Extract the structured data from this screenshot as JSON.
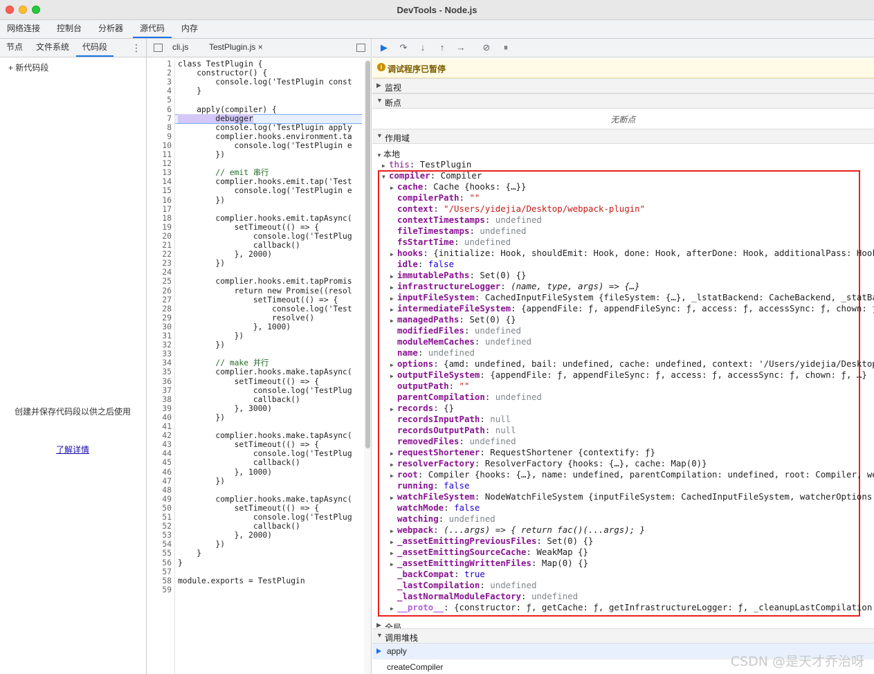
{
  "window": {
    "title": "DevTools - Node.js"
  },
  "main_tabs": [
    "网络连接",
    "控制台",
    "分析器",
    "源代码",
    "内存"
  ],
  "sources": {
    "sub_tabs": [
      "节点",
      "文件系统",
      "代码段"
    ],
    "new_snippet": "新代码段",
    "empty_message": "创建并保存代码段以供之后使用",
    "learn_more": "了解详情"
  },
  "editor": {
    "tabs": [
      {
        "label": "cli.js"
      },
      {
        "label": "TestPlugin.js",
        "close": "×"
      }
    ],
    "line_numbers": [
      "1",
      "2",
      "3",
      "4",
      "5",
      "6",
      "7",
      "8",
      "9",
      "10",
      "11",
      "12",
      "13",
      "14",
      "15",
      "16",
      "17",
      "18",
      "19",
      "20",
      "21",
      "22",
      "23",
      "24",
      "25",
      "26",
      "27",
      "28",
      "29",
      "30",
      "31",
      "32",
      "33",
      "34",
      "35",
      "36",
      "37",
      "38",
      "39",
      "40",
      "41",
      "42",
      "43",
      "44",
      "45",
      "46",
      "47",
      "48",
      "49",
      "50",
      "51",
      "52",
      "53",
      "54",
      "55",
      "56",
      "57",
      "58",
      "59"
    ],
    "lines": [
      "class TestPlugin {",
      "    constructor() {",
      "        console.log('TestPlugin const",
      "    }",
      "",
      "    apply(compiler) {",
      "        debugger",
      "        console.log('TestPlugin apply",
      "        complier.hooks.environment.ta",
      "            console.log('TestPlugin e",
      "        })",
      "",
      "        // emit 串行",
      "        complier.hooks.emit.tap('Test",
      "            console.log('TestPlugin e",
      "        })",
      "",
      "        complier.hooks.emit.tapAsync(",
      "            setTimeout(() => {",
      "                console.log('TestPlug",
      "                callback()",
      "            }, 2000)",
      "        })",
      "",
      "        complier.hooks.emit.tapPromis",
      "            return new Promise((resol",
      "                setTimeout(() => {",
      "                    console.log('Test",
      "                    resolve()",
      "                }, 1000)",
      "            })",
      "        })",
      "",
      "        // make 并行",
      "        complier.hooks.make.tapAsync(",
      "            setTimeout(() => {",
      "                console.log('TestPlug",
      "                callback()",
      "            }, 3000)",
      "        })",
      "",
      "        complier.hooks.make.tapAsync(",
      "            setTimeout(() => {",
      "                console.log('TestPlug",
      "                callback()",
      "            }, 1000)",
      "        })",
      "",
      "        complier.hooks.make.tapAsync(",
      "            setTimeout(() => {",
      "                console.log('TestPlug",
      "                callback()",
      "            }, 2000)",
      "        })",
      "    }",
      "}",
      "",
      "module.exports = TestPlugin",
      ""
    ]
  },
  "debugger": {
    "paused": "调试程序已暂停",
    "sections": {
      "watch": "监视",
      "breakpoints": "断点",
      "scope": "作用域",
      "local": "本地",
      "global": "全局",
      "callstack": "调用堆栈"
    },
    "no_breakpoints": "无断点",
    "this_row": {
      "key": "this",
      "value": "TestPlugin"
    },
    "compiler_row": {
      "key": "compiler",
      "value": "Compiler"
    },
    "props": [
      {
        "k": "cache",
        "v": "Cache {hooks: {…}}",
        "t": "obj",
        "exp": true
      },
      {
        "k": "compilerPath",
        "v": "\"\"",
        "t": "str",
        "exp": false
      },
      {
        "k": "context",
        "v": "\"/Users/yidejia/Desktop/webpack-plugin\"",
        "t": "str",
        "exp": false
      },
      {
        "k": "contextTimestamps",
        "v": "undefined",
        "t": "undef",
        "exp": false
      },
      {
        "k": "fileTimestamps",
        "v": "undefined",
        "t": "undef",
        "exp": false
      },
      {
        "k": "fsStartTime",
        "v": "undefined",
        "t": "undef",
        "exp": false
      },
      {
        "k": "hooks",
        "v": "{initialize: Hook, shouldEmit: Hook, done: Hook, afterDone: Hook, additionalPass: Hook, …",
        "t": "obj",
        "exp": true
      },
      {
        "k": "idle",
        "v": "false",
        "t": "num",
        "exp": false
      },
      {
        "k": "immutablePaths",
        "v": "Set(0) {}",
        "t": "obj",
        "exp": true
      },
      {
        "k": "infrastructureLogger",
        "v": "(name, type, args) => {…}",
        "t": "fn",
        "exp": true
      },
      {
        "k": "inputFileSystem",
        "v": "CachedInputFileSystem {fileSystem: {…}, _lstatBackend: CacheBackend, _statBacke",
        "t": "obj",
        "exp": true
      },
      {
        "k": "intermediateFileSystem",
        "v": "{appendFile: ƒ, appendFileSync: ƒ, access: ƒ, accessSync: ƒ, chown: ƒ, …",
        "t": "obj",
        "exp": true
      },
      {
        "k": "managedPaths",
        "v": "Set(0) {}",
        "t": "obj",
        "exp": true
      },
      {
        "k": "modifiedFiles",
        "v": "undefined",
        "t": "undef",
        "exp": false
      },
      {
        "k": "moduleMemCaches",
        "v": "undefined",
        "t": "undef",
        "exp": false
      },
      {
        "k": "name",
        "v": "undefined",
        "t": "undef",
        "exp": false
      },
      {
        "k": "options",
        "v": "{amd: undefined, bail: undefined, cache: undefined, context: '/Users/yidejia/Desktop/we",
        "t": "obj",
        "exp": true
      },
      {
        "k": "outputFileSystem",
        "v": "{appendFile: ƒ, appendFileSync: ƒ, access: ƒ, accessSync: ƒ, chown: ƒ, …}",
        "t": "obj",
        "exp": true
      },
      {
        "k": "outputPath",
        "v": "\"\"",
        "t": "str",
        "exp": false
      },
      {
        "k": "parentCompilation",
        "v": "undefined",
        "t": "undef",
        "exp": false
      },
      {
        "k": "records",
        "v": "{}",
        "t": "obj",
        "exp": true
      },
      {
        "k": "recordsInputPath",
        "v": "null",
        "t": "undef",
        "exp": false
      },
      {
        "k": "recordsOutputPath",
        "v": "null",
        "t": "undef",
        "exp": false
      },
      {
        "k": "removedFiles",
        "v": "undefined",
        "t": "undef",
        "exp": false
      },
      {
        "k": "requestShortener",
        "v": "RequestShortener {contextify: ƒ}",
        "t": "obj",
        "exp": true
      },
      {
        "k": "resolverFactory",
        "v": "ResolverFactory {hooks: {…}, cache: Map(0)}",
        "t": "obj",
        "exp": true
      },
      {
        "k": "root",
        "v": "Compiler {hooks: {…}, name: undefined, parentCompilation: undefined, root: Compiler, webpa",
        "t": "obj",
        "exp": true
      },
      {
        "k": "running",
        "v": "false",
        "t": "num",
        "exp": false
      },
      {
        "k": "watchFileSystem",
        "v": "NodeWatchFileSystem {inputFileSystem: CachedInputFileSystem, watcherOptions: {…",
        "t": "obj",
        "exp": true
      },
      {
        "k": "watchMode",
        "v": "false",
        "t": "num",
        "exp": false
      },
      {
        "k": "watching",
        "v": "undefined",
        "t": "undef",
        "exp": false
      },
      {
        "k": "webpack",
        "v": "(...args) => { return fac()(...args); }",
        "t": "fn",
        "exp": true
      },
      {
        "k": "_assetEmittingPreviousFiles",
        "v": "Set(0) {}",
        "t": "obj",
        "exp": true
      },
      {
        "k": "_assetEmittingSourceCache",
        "v": "WeakMap {}",
        "t": "obj",
        "exp": true
      },
      {
        "k": "_assetEmittingWrittenFiles",
        "v": "Map(0) {}",
        "t": "obj",
        "exp": true
      },
      {
        "k": "_backCompat",
        "v": "true",
        "t": "num",
        "exp": false
      },
      {
        "k": "_lastCompilation",
        "v": "undefined",
        "t": "undef",
        "exp": false
      },
      {
        "k": "_lastNormalModuleFactory",
        "v": "undefined",
        "t": "undef",
        "exp": false
      },
      {
        "k": "__proto__",
        "v": "{constructor: ƒ, getCache: ƒ, getInfrastructureLogger: ƒ, _cleanupLastCompilation: ƒ",
        "t": "obj",
        "exp": true,
        "proto": true
      }
    ],
    "call_stack": [
      "apply",
      "createCompiler"
    ]
  },
  "watermark": "CSDN @是天才乔治呀",
  "colors": {
    "highlight_box": "#e8201a",
    "accent": "#1a73e8"
  }
}
